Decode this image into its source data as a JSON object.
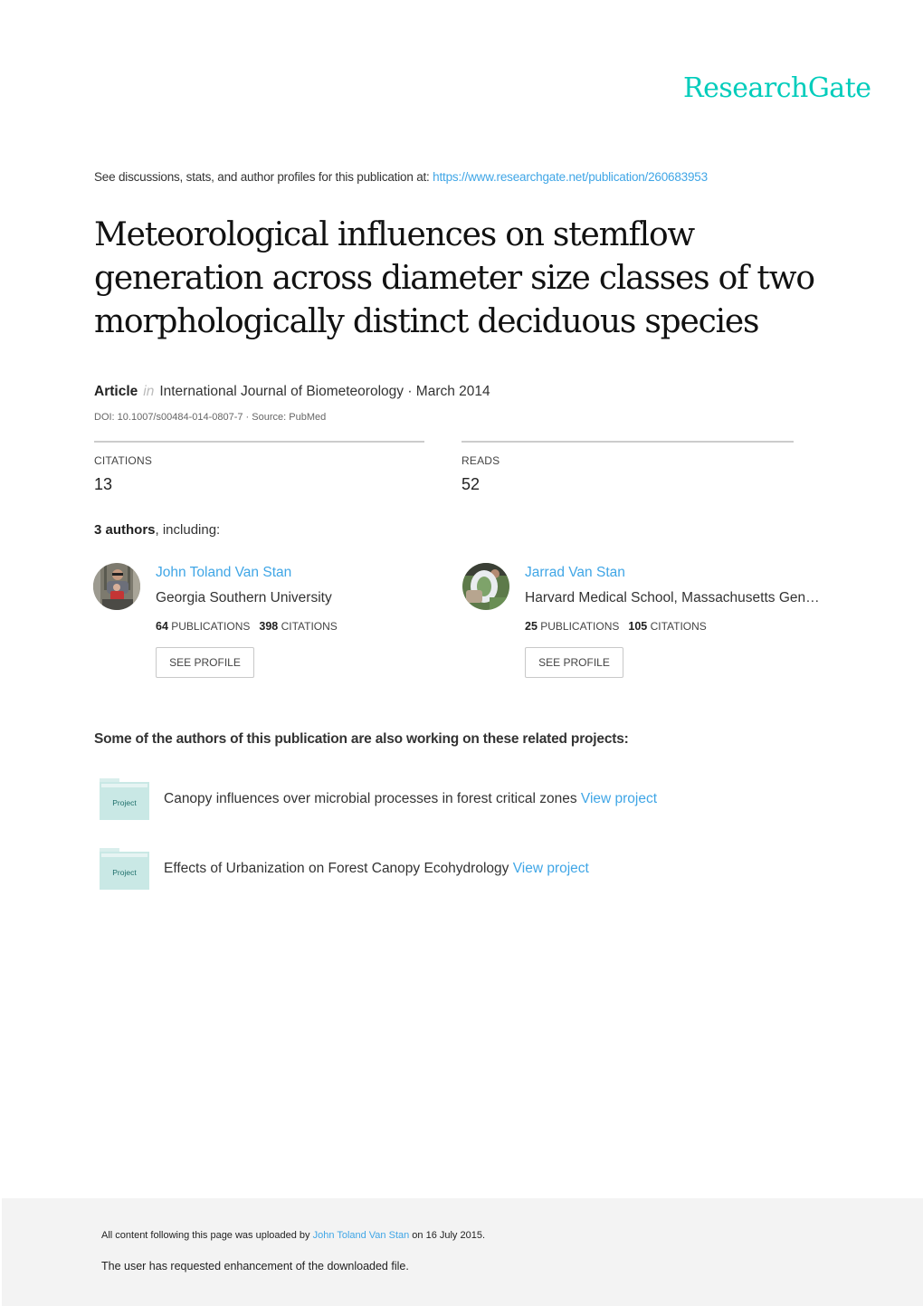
{
  "header": {
    "logo": "ResearchGate"
  },
  "discussion": {
    "prefix": "See discussions, stats, and author profiles for this publication at: ",
    "url": "https://www.researchgate.net/publication/260683953"
  },
  "publication": {
    "title": "Meteorological influences on stemflow generation across diameter size classes of two morphologically distinct deciduous species",
    "type": "Article",
    "in": "in",
    "journal": "International Journal of Biometeorology · March 2014",
    "doi_line": "DOI: 10.1007/s00484-014-0807-7 · Source: PubMed"
  },
  "stats": {
    "citations_label": "CITATIONS",
    "citations_value": "13",
    "reads_label": "READS",
    "reads_value": "52"
  },
  "authors_heading": {
    "count": "3 authors",
    "suffix": ", including:"
  },
  "authors": [
    {
      "name": "John Toland Van Stan",
      "institution": "Georgia Southern University",
      "publications": "64",
      "publications_label": "PUBLICATIONS",
      "citations": "398",
      "citations_label": "CITATIONS",
      "button": "SEE PROFILE"
    },
    {
      "name": "Jarrad Van Stan",
      "institution": "Harvard Medical School, Massachusetts Gen…",
      "publications": "25",
      "publications_label": "PUBLICATIONS",
      "citations": "105",
      "citations_label": "CITATIONS",
      "button": "SEE PROFILE"
    }
  ],
  "projects_heading": "Some of the authors of this publication are also working on these related projects:",
  "projects": [
    {
      "icon_label": "Project",
      "title": "Canopy influences over microbial processes in forest critical zones",
      "link": "View project"
    },
    {
      "icon_label": "Project",
      "title": "Effects of Urbanization on Forest Canopy Ecohydrology",
      "link": "View project"
    }
  ],
  "footer": {
    "upload_prefix": "All content following this page was uploaded by ",
    "uploader": "John Toland Van Stan",
    "upload_suffix": " on 16 July 2015.",
    "request_note": "The user has requested enhancement of the downloaded file."
  },
  "colors": {
    "brand": "#00ccbb",
    "link": "#40a6e6",
    "project_icon": "#c9e8e5",
    "footer_bg": "#f3f3f3"
  }
}
